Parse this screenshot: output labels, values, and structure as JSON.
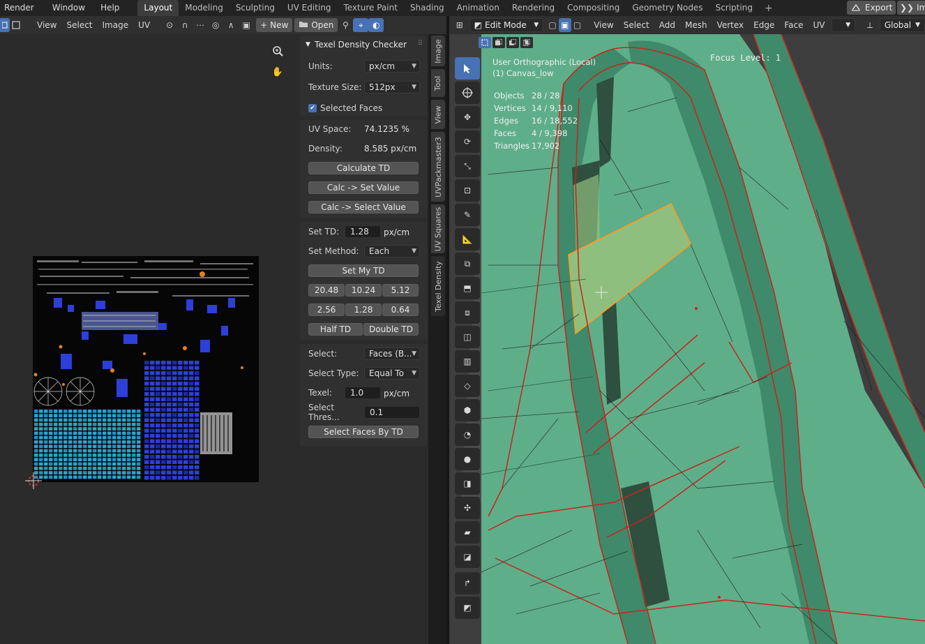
{
  "topbar": {
    "menus": [
      "Render",
      "Window",
      "Help"
    ],
    "workspaces": [
      "Layout",
      "Modeling",
      "Sculpting",
      "UV Editing",
      "Texture Paint",
      "Shading",
      "Animation",
      "Rendering",
      "Compositing",
      "Geometry Nodes",
      "Scripting"
    ],
    "active_workspace": "Layout",
    "add_tab": "+",
    "export_label": "Export",
    "import_label": "Imp"
  },
  "uv_header": {
    "menus": [
      "View",
      "Select",
      "Image",
      "UV"
    ],
    "new_label": "New",
    "open_label": "Open"
  },
  "npanel": {
    "title": "Texel Density Checker",
    "units_label": "Units:",
    "units_value": "px/cm",
    "texture_size_label": "Texture Size:",
    "texture_size_value": "512px",
    "selected_faces_label": "Selected Faces",
    "selected_faces_checked": true,
    "uv_space_label": "UV Space:",
    "uv_space_value": "74.1235 %",
    "density_label": "Density:",
    "density_value": "8.585 px/cm",
    "calculate_td": "Calculate TD",
    "calc_set_value": "Calc -> Set Value",
    "calc_select_value": "Calc -> Select Value",
    "set_td_label": "Set TD:",
    "set_td_value": "1.28",
    "set_td_unit": "px/cm",
    "set_method_label": "Set Method:",
    "set_method_value": "Each",
    "set_my_td": "Set My TD",
    "presets_row1": [
      "20.48",
      "10.24",
      "5.12"
    ],
    "presets_row2": [
      "2.56",
      "1.28",
      "0.64"
    ],
    "half_td": "Half TD",
    "double_td": "Double TD",
    "select_label": "Select:",
    "select_value": "Faces (B...",
    "select_type_label": "Select Type:",
    "select_type_value": "Equal To",
    "texel_label": "Texel:",
    "texel_value": "1.0",
    "texel_unit": "px/cm",
    "select_thres_label": "Select Thres...",
    "select_thres_value": "0.1",
    "select_faces_by_td": "Select Faces By TD"
  },
  "vertical_tabs": [
    "Image",
    "Tool",
    "View",
    "UVPackmaster3",
    "UV Squares",
    "Texel Density"
  ],
  "active_vertical_tab": "Texel Density",
  "vp_header": {
    "mode": "Edit Mode",
    "menus": [
      "View",
      "Select",
      "Add",
      "Mesh",
      "Vertex",
      "Edge",
      "Face",
      "UV"
    ],
    "orientation": "Global"
  },
  "viewport": {
    "view_name": "User Orthographic (Local)",
    "object_name": "(1) Canvas_low",
    "focus_level": "Focus Level: 1",
    "stats": [
      {
        "k": "Objects",
        "v": "28 / 28"
      },
      {
        "k": "Vertices",
        "v": "14 / 9,110"
      },
      {
        "k": "Edges",
        "v": "16 / 18,552"
      },
      {
        "k": "Faces",
        "v": "4 / 9,398"
      },
      {
        "k": "Triangles",
        "v": "17,902"
      }
    ]
  },
  "colors": {
    "accent": "#4772b3",
    "mesh_face": "#5fae8a",
    "mesh_edge": "#c7241c",
    "selected_face": "#8fbf7f",
    "uv_blue": "#2d3fd9",
    "uv_cyan": "#2aa6c8"
  }
}
